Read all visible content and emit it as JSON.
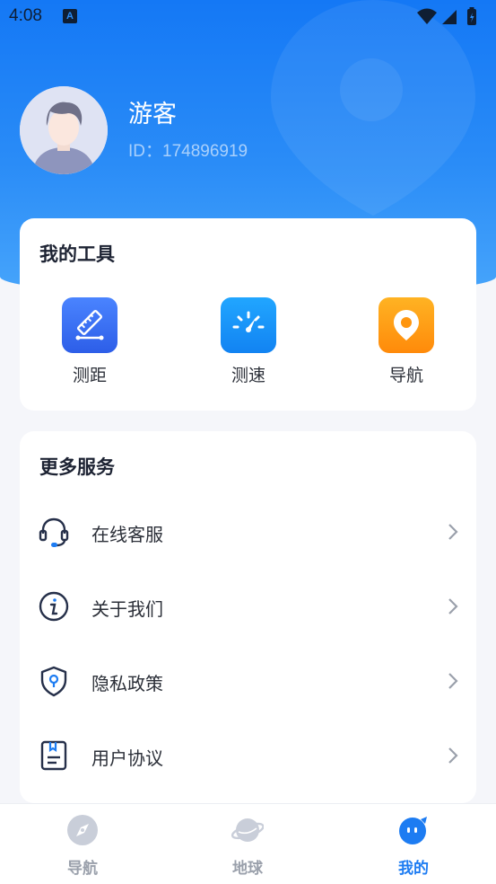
{
  "status_bar": {
    "time": "4:08",
    "badge": "A"
  },
  "profile": {
    "name": "游客",
    "id": "ID：174896919"
  },
  "tools": {
    "title": "我的工具",
    "items": [
      {
        "label": "测距",
        "icon": "ruler-icon",
        "color": "#3a6ff5"
      },
      {
        "label": "测速",
        "icon": "speedometer-icon",
        "color": "#1890ff"
      },
      {
        "label": "导航",
        "icon": "location-pin-icon",
        "color": "#ff9a14"
      }
    ]
  },
  "services": {
    "title": "更多服务",
    "items": [
      {
        "label": "在线客服",
        "icon": "headset-icon"
      },
      {
        "label": "关于我们",
        "icon": "info-icon"
      },
      {
        "label": "隐私政策",
        "icon": "shield-icon"
      },
      {
        "label": "用户协议",
        "icon": "document-icon"
      }
    ]
  },
  "tabbar": {
    "items": [
      {
        "label": "导航",
        "icon": "compass-icon",
        "active": false
      },
      {
        "label": "地球",
        "icon": "planet-icon",
        "active": false
      },
      {
        "label": "我的",
        "icon": "mine-face-icon",
        "active": true
      }
    ],
    "active_color": "#1d7cf2",
    "inactive_color": "#9aa0ab"
  },
  "colors": {
    "brand": "#1478f5",
    "background": "#f5f6fa"
  }
}
